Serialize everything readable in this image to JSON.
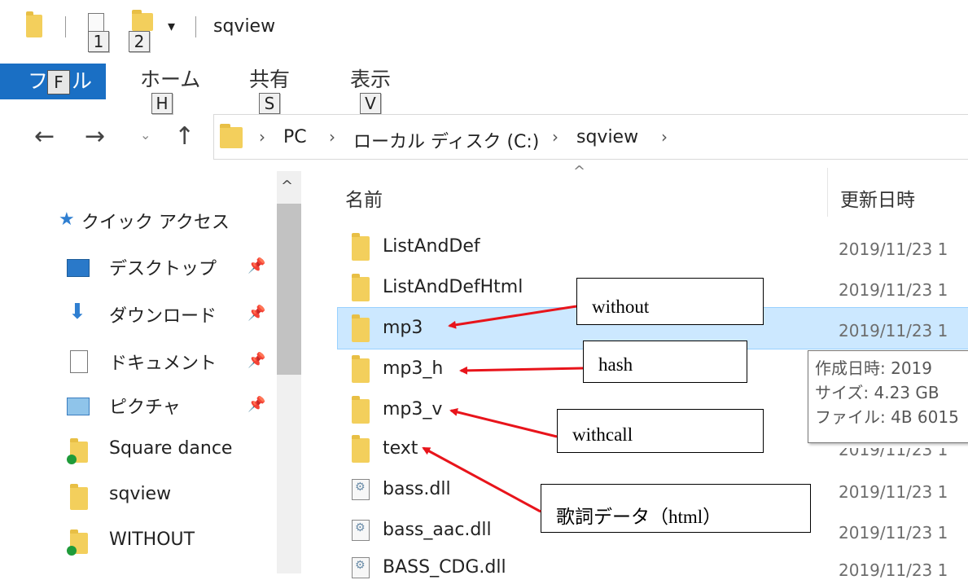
{
  "title_bar": {
    "window_title": "sqview",
    "keytips": [
      "1",
      "2"
    ]
  },
  "ribbon": {
    "file_label": "フ",
    "file_keytip": "F",
    "file_suffix": "ル",
    "tabs": [
      {
        "label": "ホーム",
        "keytip": "H"
      },
      {
        "label": "共有",
        "keytip": "S"
      },
      {
        "label": "表示",
        "keytip": "V"
      }
    ]
  },
  "address_bar": {
    "breadcrumbs": [
      "PC",
      "ローカル ディスク (C:)",
      "sqview"
    ]
  },
  "nav_pane": {
    "items": [
      {
        "label": "クイック アクセス",
        "icon": "star-icon"
      },
      {
        "label": "デスクトップ",
        "icon": "desktop-icon",
        "pinned": true
      },
      {
        "label": "ダウンロード",
        "icon": "download-icon",
        "pinned": true
      },
      {
        "label": "ドキュメント",
        "icon": "document-icon",
        "pinned": true
      },
      {
        "label": "ピクチャ",
        "icon": "pictures-icon",
        "pinned": true
      },
      {
        "label": "Square dance",
        "icon": "folder-sync-icon"
      },
      {
        "label": "sqview",
        "icon": "folder-icon"
      },
      {
        "label": "WITHOUT",
        "icon": "folder-sync-icon"
      }
    ]
  },
  "file_list": {
    "columns": {
      "name": "名前",
      "modified": "更新日時"
    },
    "rows": [
      {
        "name": "ListAndDef",
        "date": "2019/11/23 1",
        "type": "folder"
      },
      {
        "name": "ListAndDefHtml",
        "date": "2019/11/23 1",
        "type": "folder"
      },
      {
        "name": "mp3",
        "date": "2019/11/23 1",
        "type": "folder",
        "selected": true
      },
      {
        "name": "mp3_h",
        "date": "",
        "type": "folder"
      },
      {
        "name": "mp3_v",
        "date": "",
        "type": "folder"
      },
      {
        "name": "text",
        "date": "2019/11/23 1",
        "type": "folder"
      },
      {
        "name": "bass.dll",
        "date": "2019/11/23 1",
        "type": "dll"
      },
      {
        "name": "bass_aac.dll",
        "date": "2019/11/23 1",
        "type": "dll"
      },
      {
        "name": "BASS_CDG.dll",
        "date": "2019/11/23 1",
        "type": "dll"
      }
    ]
  },
  "tooltip": {
    "created": "作成日時: 2019",
    "size": "サイズ: 4.23 GB",
    "files": "ファイル: 4B 6015"
  },
  "annotations": {
    "without": "without",
    "hash": "hash",
    "withcall": "withcall",
    "lyrics": "歌詞データ（html）"
  },
  "colors": {
    "accent": "#1a6fc4",
    "selection": "#cce8ff",
    "arrow": "#e8141b",
    "folder": "#f3cf5c"
  }
}
